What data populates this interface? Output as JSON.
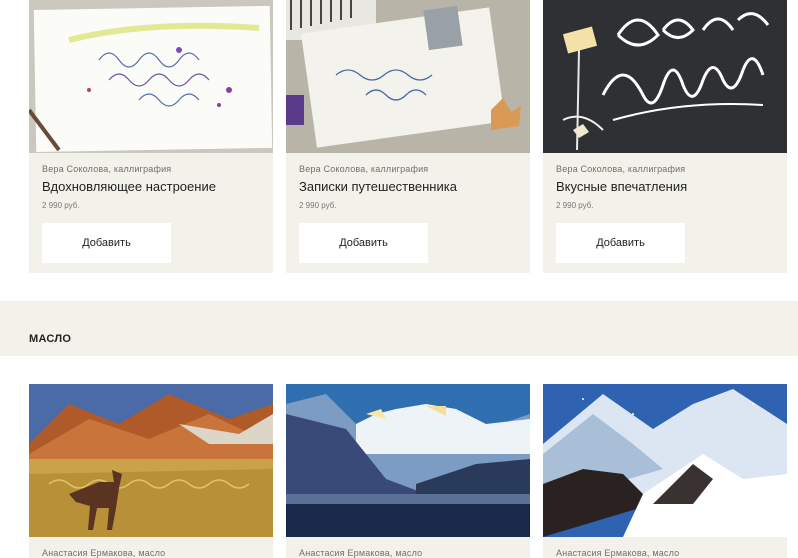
{
  "calligraphy_cards": [
    {
      "author": "Вера Соколова, каллиграфия",
      "title": "Вдохновляющее настроение",
      "price": "2 990 руб.",
      "button": "Добавить",
      "image_text": "Вдохновляющее настроение каллиграфия"
    },
    {
      "author": "Вера Соколова, каллиграфия",
      "title": "Записки путешественника",
      "price": "2 990 руб.",
      "button": "Добавить",
      "image_text": "Невероятно прекрасно"
    },
    {
      "author": "Вера Соколова, каллиграфия",
      "title": "Вкусные впечатления",
      "price": "2 990 руб.",
      "button": "Добавить",
      "image_text": "Bon appetit"
    }
  ],
  "section": {
    "title": "МАСЛО"
  },
  "oil_cards": [
    {
      "author": "Анастасия Ермакова, масло"
    },
    {
      "author": "Анастасия Ермакова, масло"
    },
    {
      "author": "Анастасия Ермакова, масло"
    }
  ],
  "colors": {
    "card_bg": "#f3f2ea",
    "button_bg": "#ffffff",
    "text": "#222222",
    "muted": "#6f6f6f"
  }
}
